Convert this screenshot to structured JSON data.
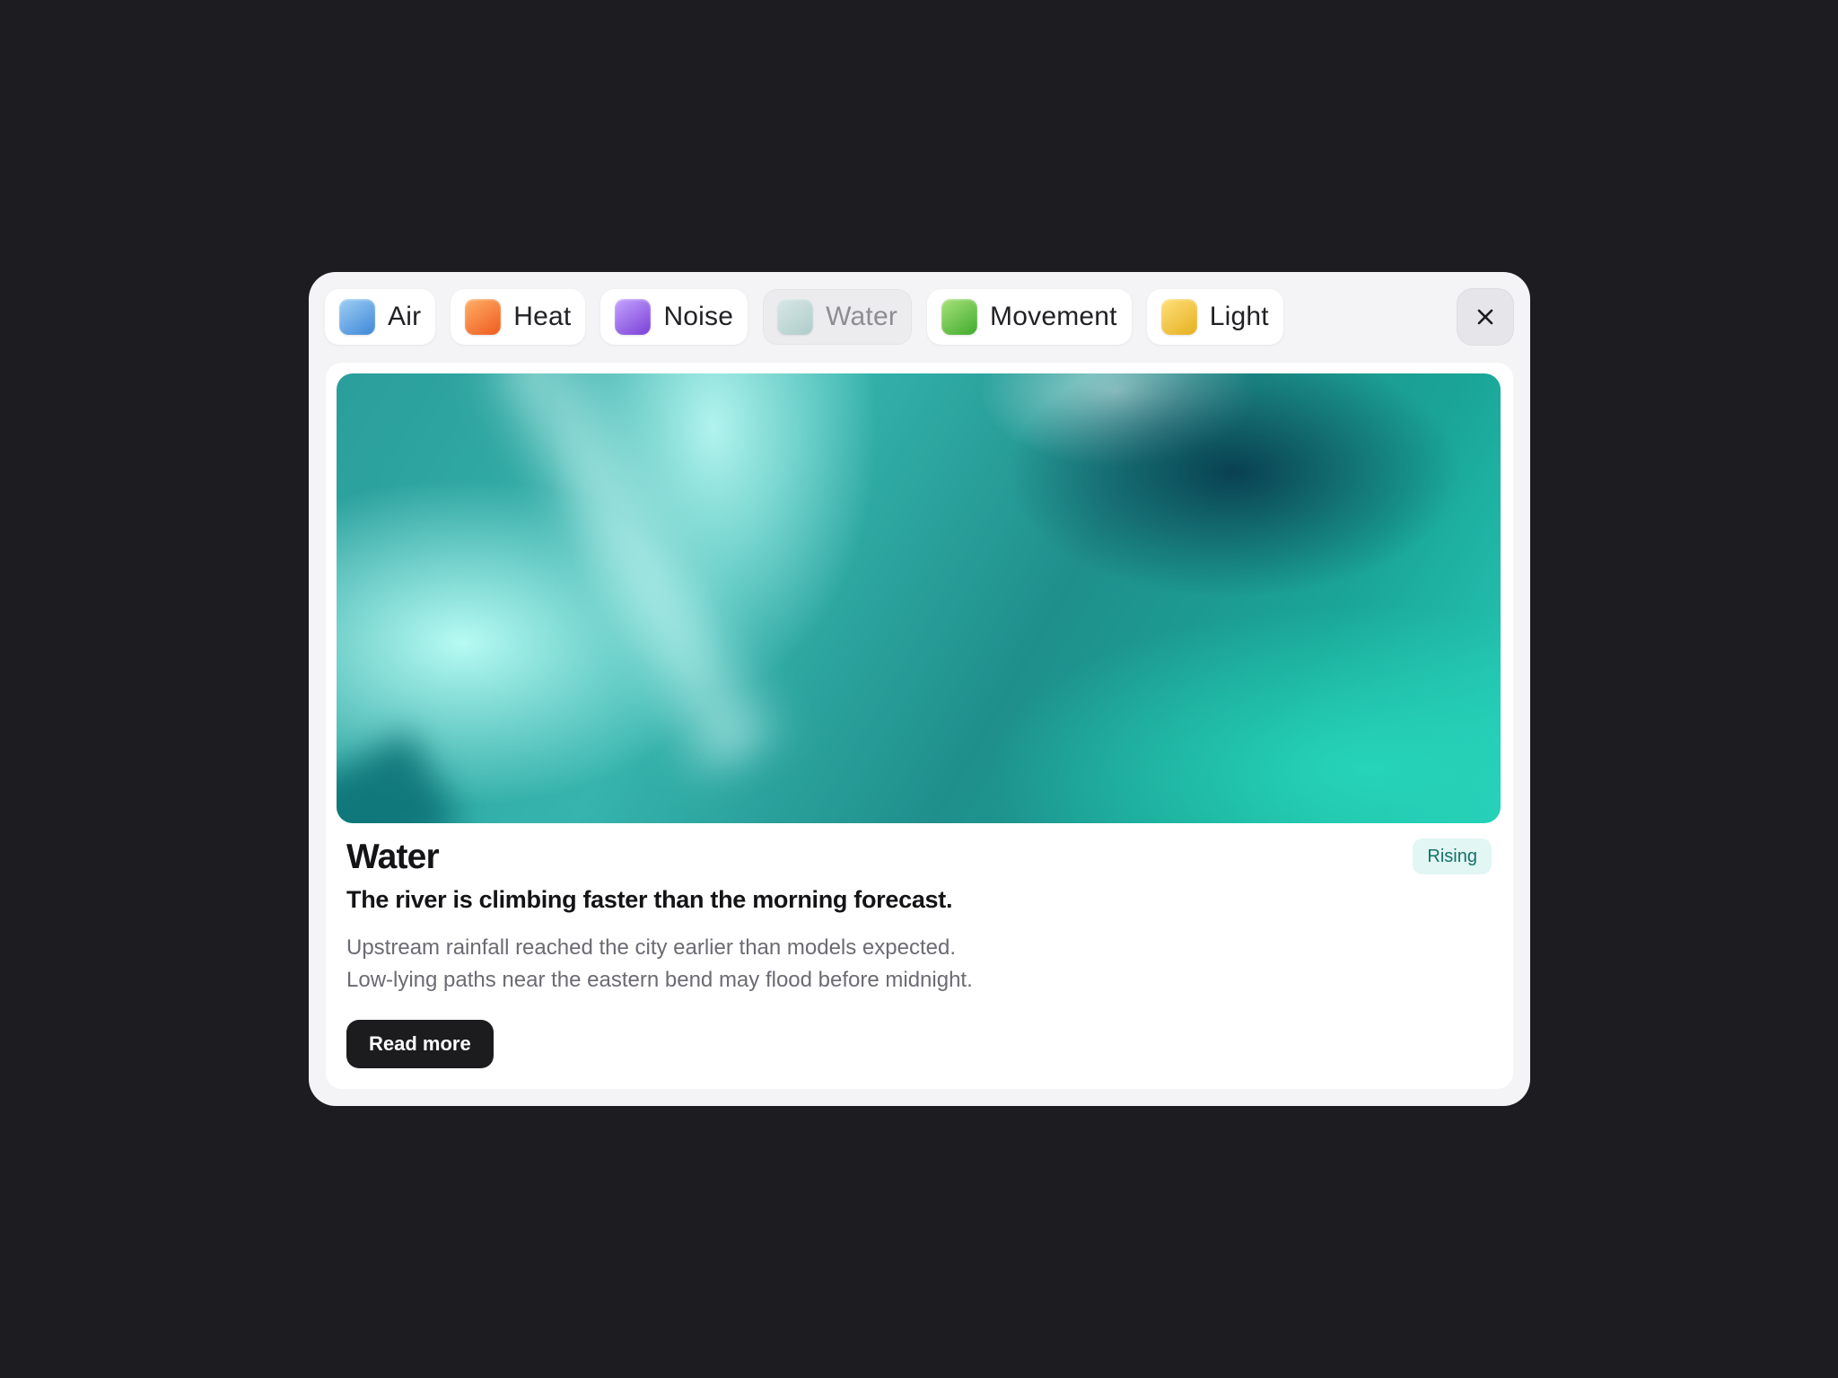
{
  "tabs": [
    {
      "label": "Air",
      "icon": "air-swatch-icon",
      "colors": [
        "#9fd0f6",
        "#3e86d6"
      ]
    },
    {
      "label": "Heat",
      "icon": "heat-swatch-icon",
      "colors": [
        "#ffb067",
        "#ef5a1e"
      ]
    },
    {
      "label": "Noise",
      "icon": "noise-swatch-icon",
      "colors": [
        "#c4a4ff",
        "#7a3fd6"
      ]
    },
    {
      "label": "Water",
      "icon": "water-swatch-icon",
      "colors": [
        "#cfe5e2",
        "#8dbdb8"
      ],
      "active": true
    },
    {
      "label": "Movement",
      "icon": "movement-swatch-icon",
      "colors": [
        "#a9e37c",
        "#3faa2c"
      ]
    },
    {
      "label": "Light",
      "icon": "light-swatch-icon",
      "colors": [
        "#ffe07a",
        "#e5b020"
      ]
    }
  ],
  "close_icon": "close-icon",
  "card": {
    "title": "Water",
    "badge": "Rising",
    "subtitle": "The river is climbing faster than the morning forecast.",
    "body_line_1": "Upstream rainfall reached the city earlier than models expected.",
    "body_line_2": "Low-lying paths near the eastern bend may flood before midnight.",
    "button_label": "Read more"
  },
  "colors": {
    "page_background": "#1d1c21",
    "modal_background": "#f4f4f6",
    "badge_background": "#e2f6f3",
    "badge_text": "#14716a",
    "button_background": "#1c1c1f"
  }
}
